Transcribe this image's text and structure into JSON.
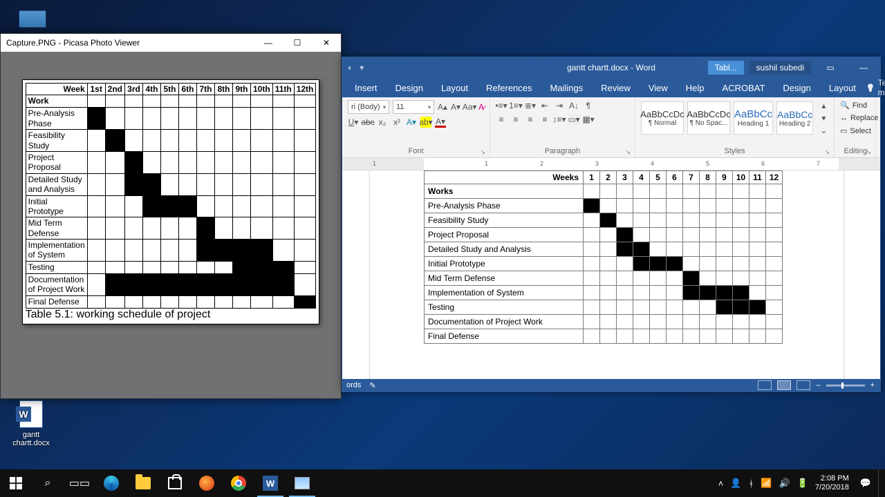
{
  "desktop": {
    "icons": {
      "pc_label": "",
      "docx_label": "gantt chartt.docx"
    }
  },
  "photo_viewer": {
    "title": "Capture.PNG - Picasa Photo Viewer",
    "gantt": {
      "corner_top": "Week",
      "corner_bottom": "Work",
      "weeks": [
        "1st",
        "2nd",
        "3rd",
        "4th",
        "5th",
        "6th",
        "7th",
        "8th",
        "9th",
        "10th",
        "11th",
        "12th"
      ],
      "rows": [
        {
          "label_l1": "Pre-Analysis",
          "label_l2": "Phase",
          "fill": [
            1
          ]
        },
        {
          "label_l1": "Feasibility",
          "label_l2": "Study",
          "fill": [
            2
          ]
        },
        {
          "label_l1": "Project",
          "label_l2": "Proposal",
          "fill": [
            3
          ]
        },
        {
          "label_l1": "Detailed Study",
          "label_l2": "and Analysis",
          "fill": [
            3,
            4
          ]
        },
        {
          "label_l1": "Initial",
          "label_l2": "Prototype",
          "fill": [
            4,
            5,
            6
          ]
        },
        {
          "label_l1": "Mid Term",
          "label_l2": "Defense",
          "fill": [
            7
          ]
        },
        {
          "label_l1": "Implementation",
          "label_l2": "of System",
          "fill": [
            7,
            8,
            9,
            10
          ]
        },
        {
          "label_l1": "Testing",
          "label_l2": "",
          "fill": [
            9,
            10,
            11
          ]
        },
        {
          "label_l1": "Documentation",
          "label_l2": "of Project Work",
          "fill": [
            2,
            3,
            4,
            5,
            6,
            7,
            8,
            9,
            10,
            11
          ]
        },
        {
          "label_l1": "Final Defense",
          "label_l2": "",
          "fill": [
            12
          ]
        }
      ],
      "caption": "Table 5.1: working schedule of project"
    }
  },
  "word": {
    "doc_title": "gantt chartt.docx  -  Word",
    "contextual_tab": "Tabl...",
    "username": "sushil subedi",
    "tabs": [
      "Insert",
      "Design",
      "Layout",
      "References",
      "Mailings",
      "Review",
      "View",
      "Help",
      "ACROBAT",
      "Design",
      "Layout"
    ],
    "active_tab_index": -1,
    "tellme": "Tell me",
    "font": {
      "name": "ri (Body)",
      "size": "11"
    },
    "groups": {
      "font": "Font",
      "paragraph": "Paragraph",
      "styles": "Styles",
      "editing": "Editing"
    },
    "styles": [
      {
        "prev": "AaBbCcDc",
        "name": "¶ Normal"
      },
      {
        "prev": "AaBbCcDc",
        "name": "¶ No Spac..."
      },
      {
        "prev": "AaBbCc",
        "name": "Heading 1"
      },
      {
        "prev": "AaBbCc",
        "name": "Heading 2"
      }
    ],
    "editing": {
      "find": "Find",
      "replace": "Replace",
      "select": "Select"
    },
    "status": {
      "words": "ords",
      "proof_icon": "✎"
    },
    "table": {
      "weeks_header": "Weeks",
      "works_header": "Works",
      "weeks": [
        "1",
        "2",
        "3",
        "4",
        "5",
        "6",
        "7",
        "8",
        "9",
        "10",
        "11",
        "12"
      ],
      "rows": [
        {
          "label": "Pre-Analysis Phase",
          "fill": [
            1
          ]
        },
        {
          "label": "Feasibility Study",
          "fill": [
            2
          ]
        },
        {
          "label": "Project Proposal",
          "fill": [
            3
          ]
        },
        {
          "label": "Detailed Study and Analysis",
          "fill": [
            3,
            4
          ]
        },
        {
          "label": "Initial Prototype",
          "fill": [
            4,
            5,
            6
          ]
        },
        {
          "label": "Mid Term Defense",
          "fill": [
            7
          ]
        },
        {
          "label": "Implementation of System",
          "fill": [
            7,
            8,
            9,
            10
          ]
        },
        {
          "label": "Testing",
          "fill": [
            9,
            10,
            11
          ]
        },
        {
          "label": "Documentation of Project Work",
          "fill": []
        },
        {
          "label": "Final Defense",
          "fill": []
        }
      ]
    }
  },
  "taskbar": {
    "clock_time": "2:08 PM",
    "clock_date": "7/20/2018"
  },
  "chart_data": [
    {
      "type": "gantt",
      "source": "Picasa Photo Viewer – Capture.PNG",
      "title": "Table 5.1: working schedule of project",
      "xlabel": "Week",
      "ylabel": "Work",
      "categories": [
        "1st",
        "2nd",
        "3rd",
        "4th",
        "5th",
        "6th",
        "7th",
        "8th",
        "9th",
        "10th",
        "11th",
        "12th"
      ],
      "series": [
        {
          "name": "Pre-Analysis Phase",
          "weeks": [
            1
          ]
        },
        {
          "name": "Feasibility Study",
          "weeks": [
            2
          ]
        },
        {
          "name": "Project Proposal",
          "weeks": [
            3
          ]
        },
        {
          "name": "Detailed Study and Analysis",
          "weeks": [
            3,
            4
          ]
        },
        {
          "name": "Initial Prototype",
          "weeks": [
            4,
            5,
            6
          ]
        },
        {
          "name": "Mid Term Defense",
          "weeks": [
            7
          ]
        },
        {
          "name": "Implementation of System",
          "weeks": [
            7,
            8,
            9,
            10
          ]
        },
        {
          "name": "Testing",
          "weeks": [
            9,
            10,
            11
          ]
        },
        {
          "name": "Documentation of Project Work",
          "weeks": [
            2,
            3,
            4,
            5,
            6,
            7,
            8,
            9,
            10,
            11
          ]
        },
        {
          "name": "Final Defense",
          "weeks": [
            12
          ]
        }
      ]
    },
    {
      "type": "gantt",
      "source": "Microsoft Word – gantt chartt.docx",
      "xlabel": "Weeks",
      "ylabel": "Works",
      "categories": [
        "1",
        "2",
        "3",
        "4",
        "5",
        "6",
        "7",
        "8",
        "9",
        "10",
        "11",
        "12"
      ],
      "series": [
        {
          "name": "Pre-Analysis Phase",
          "weeks": [
            1
          ]
        },
        {
          "name": "Feasibility Study",
          "weeks": [
            2
          ]
        },
        {
          "name": "Project Proposal",
          "weeks": [
            3
          ]
        },
        {
          "name": "Detailed Study and Analysis",
          "weeks": [
            3,
            4
          ]
        },
        {
          "name": "Initial Prototype",
          "weeks": [
            4,
            5,
            6
          ]
        },
        {
          "name": "Mid Term Defense",
          "weeks": [
            7
          ]
        },
        {
          "name": "Implementation of System",
          "weeks": [
            7,
            8,
            9,
            10
          ]
        },
        {
          "name": "Testing",
          "weeks": [
            9,
            10,
            11
          ]
        },
        {
          "name": "Documentation of Project Work",
          "weeks": []
        },
        {
          "name": "Final Defense",
          "weeks": []
        }
      ]
    }
  ]
}
